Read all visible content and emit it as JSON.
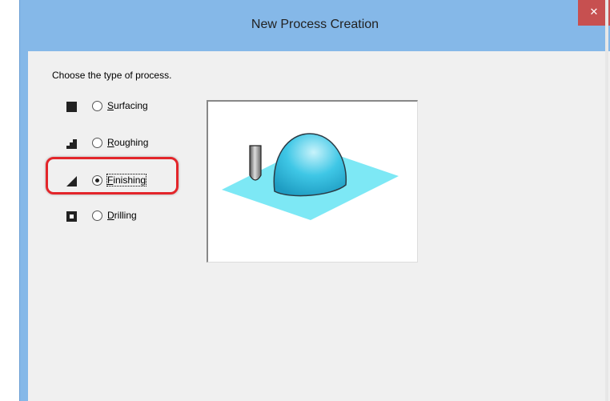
{
  "window": {
    "title": "New Process Creation",
    "close_label": "✕"
  },
  "prompt": "Choose the type of process.",
  "options": [
    {
      "accelerator": "S",
      "rest": "urfacing",
      "icon": "surfacing-icon",
      "selected": false
    },
    {
      "accelerator": "R",
      "rest": "oughing",
      "icon": "roughing-icon",
      "selected": false
    },
    {
      "accelerator": "F",
      "rest": "inishing",
      "icon": "finishing-icon",
      "selected": true
    },
    {
      "accelerator": "D",
      "rest": "rilling",
      "icon": "drilling-icon",
      "selected": false
    }
  ],
  "preview": {
    "depicts": "finishing-preview-illustration"
  },
  "colors": {
    "titlebar": "#85b8e8",
    "close": "#c75050",
    "highlight": "#e3252a",
    "plane": "#7de8f5",
    "dome": "#3fc7e6"
  }
}
